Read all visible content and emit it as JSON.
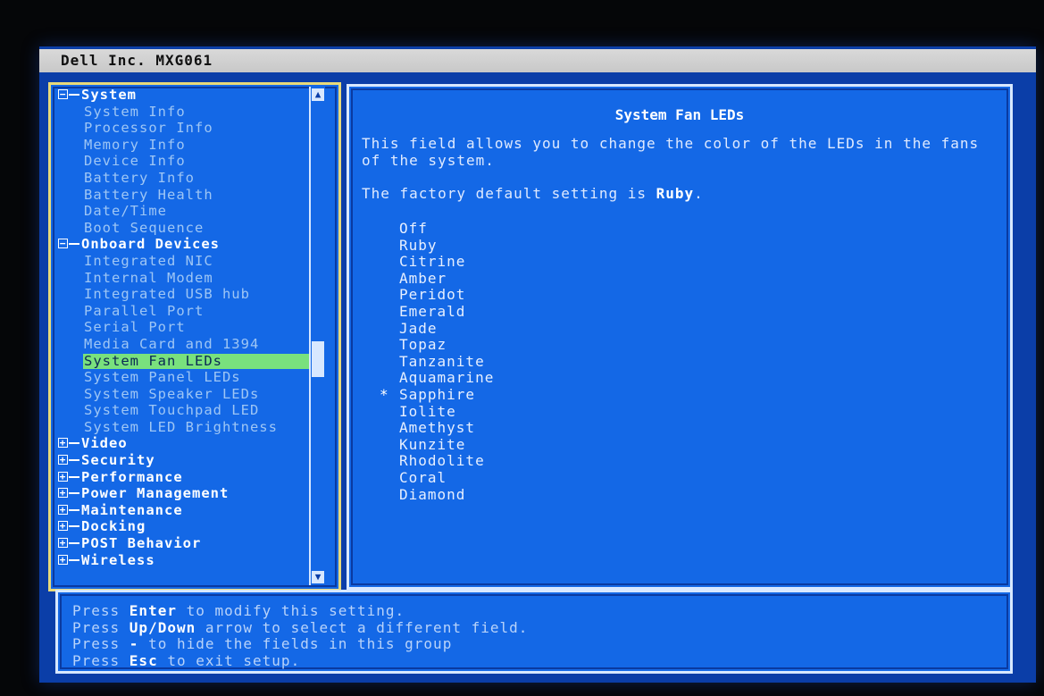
{
  "title": "Dell Inc. MXG061",
  "tree": {
    "groups": [
      {
        "label": "System",
        "expanded": true,
        "items": [
          "System Info",
          "Processor Info",
          "Memory Info",
          "Device Info",
          "Battery Info",
          "Battery Health",
          "Date/Time",
          "Boot Sequence"
        ]
      },
      {
        "label": "Onboard Devices",
        "expanded": true,
        "items": [
          "Integrated NIC",
          "Internal Modem",
          "Integrated USB hub",
          "Parallel Port",
          "Serial Port",
          "Media Card and 1394",
          "System Fan LEDs",
          "System Panel LEDs",
          "System Speaker LEDs",
          "System Touchpad LED",
          "System LED Brightness"
        ]
      },
      {
        "label": "Video",
        "expanded": false,
        "items": []
      },
      {
        "label": "Security",
        "expanded": false,
        "items": []
      },
      {
        "label": "Performance",
        "expanded": false,
        "items": []
      },
      {
        "label": "Power Management",
        "expanded": false,
        "items": []
      },
      {
        "label": "Maintenance",
        "expanded": false,
        "items": []
      },
      {
        "label": "Docking",
        "expanded": false,
        "items": []
      },
      {
        "label": "POST Behavior",
        "expanded": false,
        "items": []
      },
      {
        "label": "Wireless",
        "expanded": false,
        "items": []
      }
    ],
    "selected": "System Fan LEDs"
  },
  "help": {
    "title": "System Fan LEDs",
    "description": "This field allows you to change the color of the LEDs in the fans of the system.",
    "default_prefix": "The factory default setting is ",
    "default_value": "Ruby",
    "default_suffix": ".",
    "options": [
      "Off",
      "Ruby",
      "Citrine",
      "Amber",
      "Peridot",
      "Emerald",
      "Jade",
      "Topaz",
      "Tanzanite",
      "Aquamarine",
      "Sapphire",
      "Iolite",
      "Amethyst",
      "Kunzite",
      "Rhodolite",
      "Coral",
      "Diamond"
    ],
    "current": "Sapphire",
    "current_marker": "*"
  },
  "footer": [
    {
      "pre": "Press ",
      "key": "Enter",
      "post": " to modify this setting."
    },
    {
      "pre": "Press ",
      "key": "Up/Down",
      "post": " arrow to select a different field."
    },
    {
      "pre": "Press ",
      "key": "-",
      "post": " to hide the fields in this group"
    },
    {
      "pre": "Press ",
      "key": "Esc",
      "post": " to exit setup."
    }
  ],
  "icons": {
    "expanded": "minus-box-icon",
    "collapsed": "plus-box-icon",
    "scroll_up": "arrow-up-icon",
    "scroll_down": "arrow-down-icon"
  }
}
